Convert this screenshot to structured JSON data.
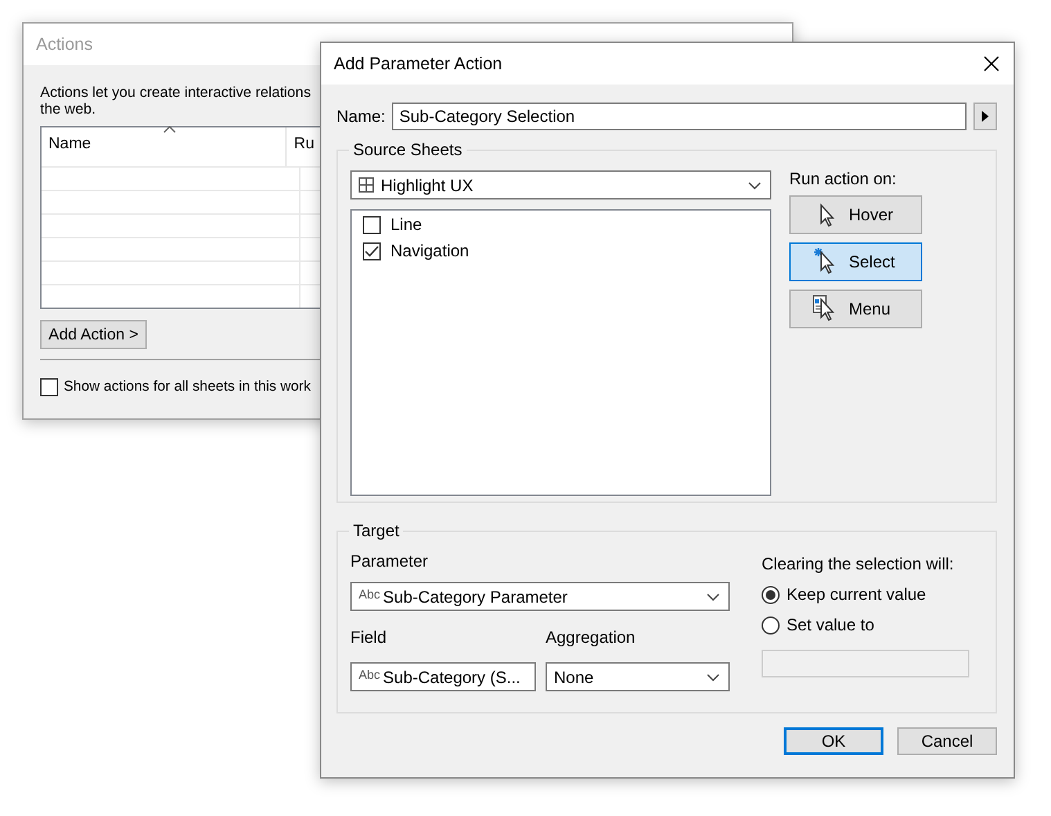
{
  "actions_window": {
    "title": "Actions",
    "description_lines": [
      "Actions let you create interactive relations",
      "the web."
    ],
    "table": {
      "columns": [
        "Name",
        "Ru"
      ]
    },
    "add_button": "Add Action >",
    "show_all_checkbox": {
      "label": "Show actions for all sheets in this work",
      "checked": false
    }
  },
  "dialog": {
    "title": "Add Parameter Action",
    "name_label": "Name:",
    "name_value": "Sub-Category Selection",
    "source_sheets": {
      "legend": "Source Sheets",
      "dashboard": "Highlight UX",
      "sheets": [
        {
          "label": "Line",
          "checked": false
        },
        {
          "label": "Navigation",
          "checked": true
        }
      ],
      "run_on_label": "Run action on:",
      "run_on": [
        {
          "label": "Hover",
          "kind": "hover",
          "selected": false
        },
        {
          "label": "Select",
          "kind": "select",
          "selected": true
        },
        {
          "label": "Menu",
          "kind": "menu",
          "selected": false
        }
      ]
    },
    "target": {
      "legend": "Target",
      "parameter_label": "Parameter",
      "parameter": {
        "type_badge": "Abc",
        "value": "Sub-Category Parameter"
      },
      "field_label": "Field",
      "field": {
        "type_badge": "Abc",
        "value": "Sub-Category (S..."
      },
      "aggregation_label": "Aggregation",
      "aggregation": "None",
      "clearing_label": "Clearing the selection will:",
      "clearing_options": [
        {
          "label": "Keep current value",
          "selected": true
        },
        {
          "label": "Set value to",
          "selected": false
        }
      ],
      "set_value_field": {
        "disabled": true
      }
    },
    "buttons": [
      {
        "label": "OK",
        "kind": "default"
      },
      {
        "label": "Cancel",
        "kind": "normal"
      }
    ]
  }
}
